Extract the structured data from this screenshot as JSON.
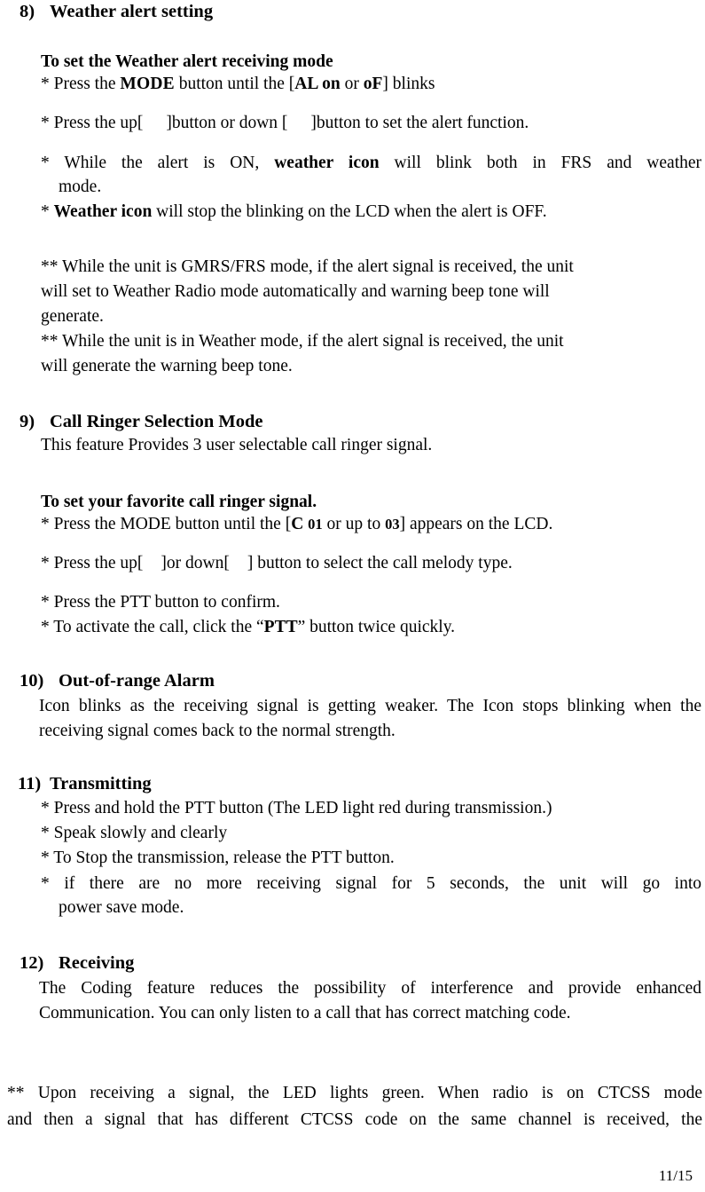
{
  "document": {
    "page_label": "11/15",
    "sections": [
      {
        "number": "8)",
        "title": "Weather alert setting",
        "subheading": "To set the Weather alert receiving mode",
        "lines": {
          "press_mode_prefix": "* Press the ",
          "press_mode_bold": "MODE",
          "press_mode_mid": " button until the [",
          "press_mode_al": "AL on",
          "press_mode_or": " or ",
          "press_mode_of": "oF",
          "press_mode_suffix": "] blinks",
          "press_updown_a": "* Press the up[",
          "press_updown_b": "]button or down [",
          "press_updown_c": "]button to set the alert function.",
          "while_alert_a": "* While the alert is ON, ",
          "while_alert_bold": "weather icon",
          "while_alert_b": " will blink both in FRS and weather",
          "while_alert_cont": "mode.",
          "weather_icon_star": "* ",
          "weather_icon_bold": "Weather icon",
          "weather_icon_rest": " will stop the blinking on the LCD when the alert is OFF.",
          "note1_l1": "** While the unit is GMRS/FRS mode, if the alert signal is received, the unit",
          "note1_l2": "will set to Weather Radio mode automatically and warning beep tone will",
          "note1_l3": "generate.",
          "note2_l1": "** While the unit is in Weather mode, if the alert signal is received, the unit",
          "note2_l2": "will generate the warning beep tone."
        }
      },
      {
        "number": "9)",
        "title": "Call Ringer Selection Mode",
        "intro": "This feature Provides 3 user selectable call ringer signal.",
        "subheading": "To set your favorite call ringer signal.",
        "lines": {
          "press_mode_prefix": "* Press the MODE button until the [",
          "press_mode_c": "C",
          "press_mode_01": "01",
          "press_mode_mid": " or up to ",
          "press_mode_03": "03",
          "press_mode_suffix": "] appears on the LCD.",
          "press_updown_a": "* Press the up[",
          "press_updown_b": "]or down[",
          "press_updown_c": "] button to select the call melody type.",
          "press_ptt": "* Press the PTT button to confirm.",
          "activate_a": "* To activate the call, click the “",
          "activate_bold": "PTT",
          "activate_b": "” button twice quickly."
        }
      },
      {
        "number": "10)",
        "title": "Out-of-range Alarm",
        "body": "Icon blinks as the receiving signal is getting weaker. The Icon stops blinking when the receiving signal comes back to the normal strength."
      },
      {
        "number": "11)",
        "title": "Transmitting",
        "lines": {
          "l1": "* Press and hold the PTT button (The LED light red during transmission.)",
          "l2": "* Speak slowly and clearly",
          "l3": "* To Stop the transmission, release the PTT button.",
          "l4": "* if there are no more receiving signal for 5 seconds, the unit will go into",
          "l4_cont": "power save mode."
        }
      },
      {
        "number": "12)",
        "title": "Receiving",
        "body": "The Coding feature reduces the possibility of interference and provide enhanced Communication. You can only listen to a call that has correct matching code."
      }
    ],
    "closing_note": {
      "l1": "** Upon receiving a signal, the LED lights green. When radio is on CTCSS mode",
      "l2": "and then a signal that has different CTCSS code on the same channel is received, the"
    }
  }
}
